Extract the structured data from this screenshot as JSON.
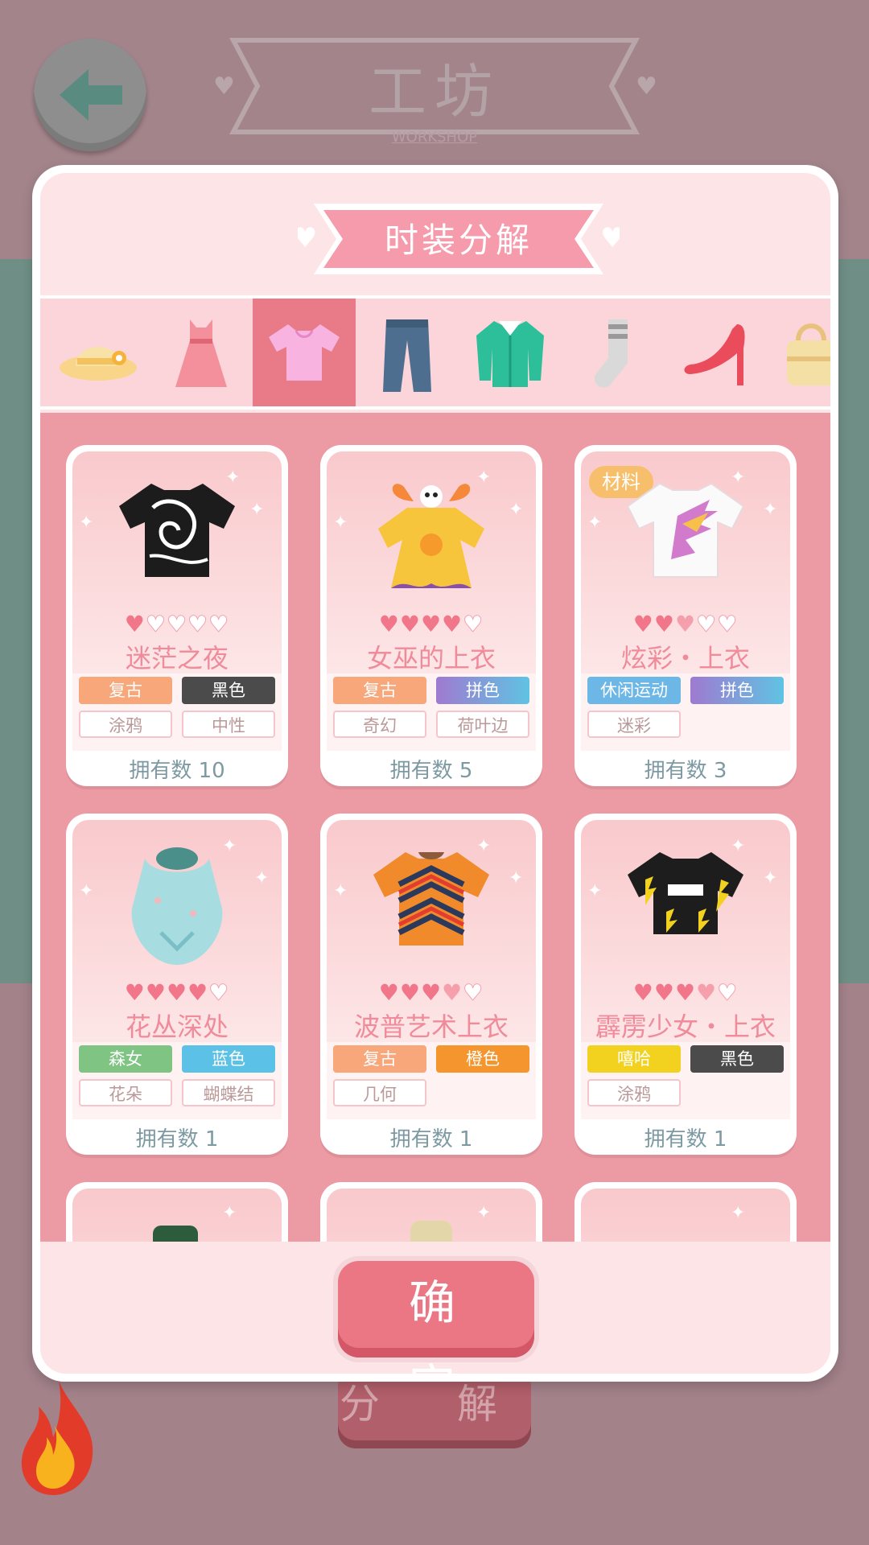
{
  "background": {
    "title": "工坊",
    "subtitle": "WORKSHOP",
    "ghost_button": "分 解"
  },
  "dialog": {
    "title": "时装分解",
    "confirm_label": "确 定",
    "tabs": [
      {
        "icon": "hat-icon",
        "active": false
      },
      {
        "icon": "dress-icon",
        "active": false
      },
      {
        "icon": "top-icon",
        "active": true
      },
      {
        "icon": "pants-icon",
        "active": false
      },
      {
        "icon": "coat-icon",
        "active": false
      },
      {
        "icon": "sock-icon",
        "active": false
      },
      {
        "icon": "heel-shoe-icon",
        "active": false
      },
      {
        "icon": "bag-icon",
        "active": false
      }
    ],
    "owned_prefix": "拥有数",
    "items": [
      {
        "name": "迷茫之夜",
        "rating": 1,
        "tags": [
          {
            "text": "复古",
            "color": "#f7a77a"
          },
          {
            "text": "黑色",
            "color": "#4b4b4b"
          },
          {
            "text": "涂鸦"
          },
          {
            "text": "中性"
          }
        ],
        "owned": "拥有数 10",
        "material": ""
      },
      {
        "name": "女巫的上衣",
        "rating": 4,
        "tags": [
          {
            "text": "复古",
            "color": "#f7a77a"
          },
          {
            "text": "拼色",
            "color": "#8f7fd6"
          },
          {
            "text": "奇幻"
          },
          {
            "text": "荷叶边"
          }
        ],
        "owned": "拥有数 5",
        "material": ""
      },
      {
        "name": "炫彩・上衣",
        "rating": 2.5,
        "tags": [
          {
            "text": "休闲运动",
            "color": "#6cb7e6"
          },
          {
            "text": "拼色",
            "color": "#8f7fd6"
          },
          {
            "text": "迷彩"
          }
        ],
        "owned": "拥有数 3",
        "material": "材料"
      },
      {
        "name": "花丛深处",
        "rating": 4,
        "tags": [
          {
            "text": "森女",
            "color": "#7fc483"
          },
          {
            "text": "蓝色",
            "color": "#5cc1e6"
          },
          {
            "text": "花朵"
          },
          {
            "text": "蝴蝶结"
          }
        ],
        "owned": "拥有数 1",
        "material": ""
      },
      {
        "name": "波普艺术上衣",
        "rating": 3.5,
        "tags": [
          {
            "text": "复古",
            "color": "#f7a77a"
          },
          {
            "text": "橙色",
            "color": "#f4962d"
          },
          {
            "text": "几何"
          }
        ],
        "owned": "拥有数 1",
        "material": ""
      },
      {
        "name": "霹雳少女・上衣",
        "rating": 3.5,
        "tags": [
          {
            "text": "嘻哈",
            "color": "#f2d21e"
          },
          {
            "text": "黑色",
            "color": "#4b4b4b"
          },
          {
            "text": "涂鸦"
          }
        ],
        "owned": "拥有数 1",
        "material": ""
      }
    ]
  }
}
